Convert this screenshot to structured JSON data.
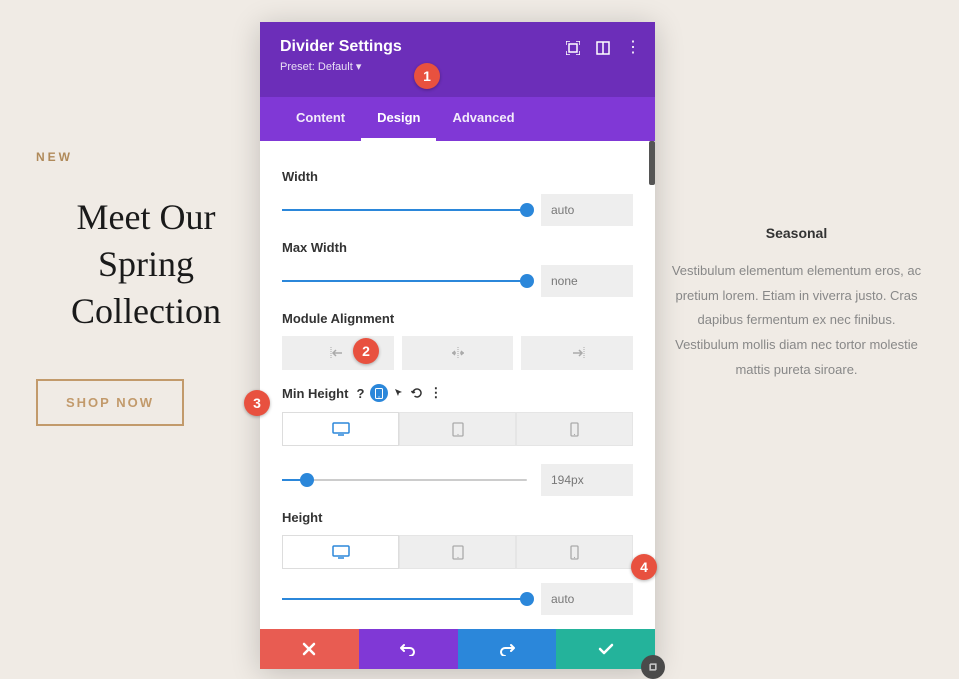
{
  "background": {
    "new_label": "NEW",
    "heading": "Meet Our Spring Collection",
    "cta": "SHOP NOW",
    "side_title": "Seasonal",
    "side_body": "Vestibulum elementum elementum eros, ac pretium lorem. Etiam in viverra justo. Cras dapibus fermentum ex nec finibus. Vestibulum mollis diam nec tortor molestie mattis pureta siroare."
  },
  "panel": {
    "title": "Divider Settings",
    "preset_label": "Preset: Default ▾",
    "tabs": {
      "content": "Content",
      "design": "Design",
      "advanced": "Advanced",
      "active": "design"
    },
    "fields": {
      "width": {
        "label": "Width",
        "value": "auto",
        "pos": 100
      },
      "max_width": {
        "label": "Max Width",
        "value": "none",
        "pos": 100
      },
      "module_alignment": {
        "label": "Module Alignment"
      },
      "min_height": {
        "label": "Min Height",
        "value": "194px",
        "pos": 10
      },
      "height": {
        "label": "Height",
        "value": "auto",
        "pos": 100
      }
    }
  },
  "callouts": {
    "c1": "1",
    "c2": "2",
    "c3": "3",
    "c4": "4"
  },
  "colors": {
    "purple_dark": "#6c2eb9",
    "purple": "#8038d6",
    "blue": "#2b87da",
    "green": "#24b39b",
    "red": "#e85c52"
  }
}
